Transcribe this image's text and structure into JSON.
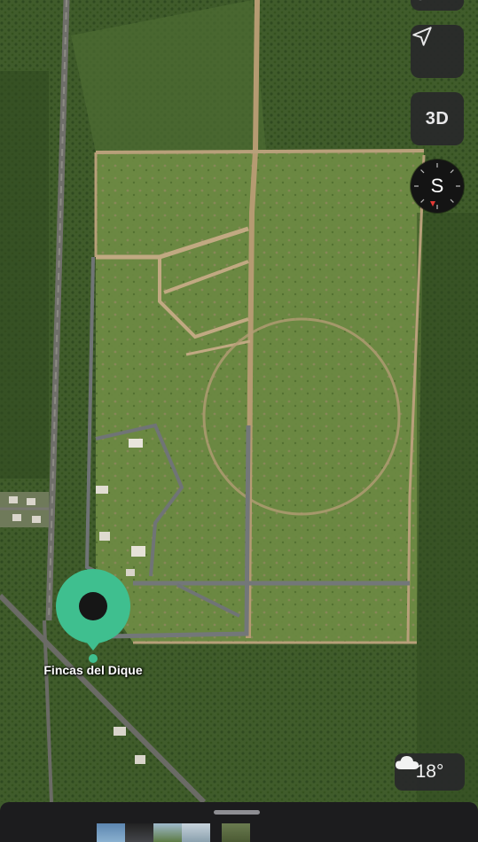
{
  "map": {
    "type": "satellite",
    "place_label": "Fincas del Dique",
    "pin_color": "#3fbf8f"
  },
  "controls": {
    "top_button_icon": "map-mode-icon",
    "locate_icon": "location-arrow-icon",
    "three_d_label": "3D",
    "compass_heading": "S",
    "compass_marker_color": "#e53935"
  },
  "weather": {
    "icon": "cloud-icon",
    "temperature": "18°"
  },
  "bottom_sheet": {
    "photo_thumbnails": [
      "photo-1",
      "photo-2",
      "photo-3",
      "photo-4",
      "photo-5"
    ]
  }
}
